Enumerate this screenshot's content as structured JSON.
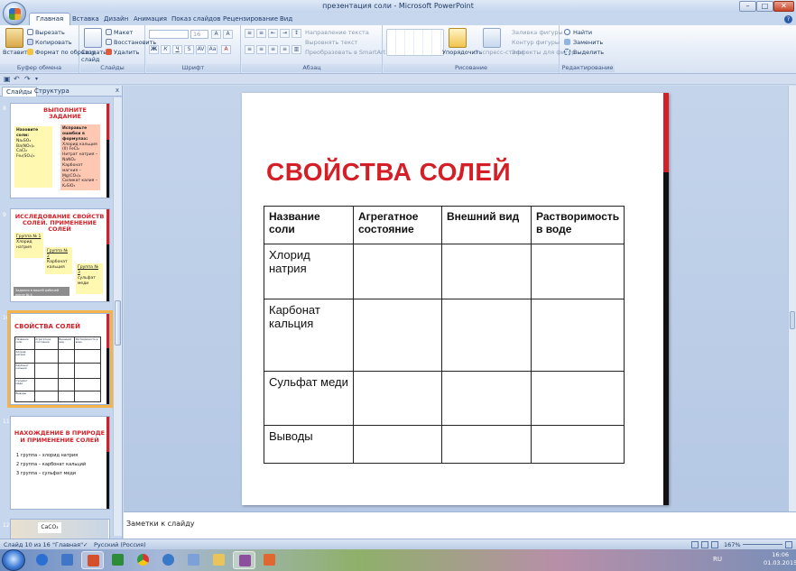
{
  "window": {
    "title": "презентация соли - Microsoft PowerPoint"
  },
  "tabs": [
    "Главная",
    "Вставка",
    "Дизайн",
    "Анимация",
    "Показ слайдов",
    "Рецензирование",
    "Вид"
  ],
  "ribbon": {
    "clipboard": {
      "label": "Буфер обмена",
      "paste": "Вставить",
      "cut": "Вырезать",
      "copy": "Копировать",
      "format_painter": "Формат по образцу"
    },
    "slides": {
      "label": "Слайды",
      "new_slide": "Создать слайд",
      "layout": "Макет",
      "reset": "Восстановить",
      "delete": "Удалить"
    },
    "font": {
      "label": "Шрифт",
      "size": "16"
    },
    "paragraph": {
      "label": "Абзац",
      "text_direction": "Направление текста",
      "align_text": "Выровнять текст",
      "smartart": "Преобразовать в SmartArt"
    },
    "drawing": {
      "label": "Рисование",
      "arrange": "Упорядочить",
      "quick_styles": "Экспресс-стили",
      "fill": "Заливка фигуры",
      "outline": "Контур фигуры",
      "effects": "Эффекты для фигур"
    },
    "editing": {
      "label": "Редактирование",
      "find": "Найти",
      "replace": "Заменить",
      "select": "Выделить"
    }
  },
  "panel": {
    "tab_slides": "Слайды",
    "tab_outline": "Структура",
    "close": "x"
  },
  "thumbnails": [
    {
      "number": "8",
      "title": "ВЫПОЛНИТЕ ЗАДАНИЕ",
      "note1_heading": "Назовите соли:",
      "note1_lines": [
        "Na₂SO₄",
        "Ba(NO₃)₂",
        "CaCl₂",
        "Fe₂(SO₄)₃"
      ],
      "note2_heading": "Исправьте ошибки в формулах:",
      "note2_lines": [
        "Хлорид кальция (II) FeCl₂",
        "Нитрат натрия – NaNO₂",
        "Карбонат магния – Mg(CO₃)₂",
        "Силикат калия – K₂SiO₃"
      ]
    },
    {
      "number": "9",
      "title": "ИССЛЕДОВАНИЕ СВОЙСТВ СОЛЕЙ. ПРИМЕНЕНИЕ СОЛЕЙ",
      "group1": "Группа № 1",
      "group1_text": "Хлорид натрия",
      "group2": "Группа № 2",
      "group2_text": "Карбонат кальция",
      "group3": "Группа № 3",
      "group3_text": "сульфат меди",
      "bar_text": "Задания в вашей рабочей листе № 4"
    },
    {
      "number": "10",
      "title": "СВОЙСТВА СОЛЕЙ"
    },
    {
      "number": "11",
      "title": "НАХОЖДЕНИЕ В ПРИРОДЕ И ПРИМЕНЕНИЕ СОЛЕЙ",
      "lines": [
        "1 группа – хлорид натрия",
        "2 группа – карбонат кальций",
        "3 группа – сульфат меди"
      ]
    },
    {
      "number": "12",
      "label": "CaCO₃"
    }
  ],
  "slide": {
    "title": "СВОЙСТВА СОЛЕЙ",
    "headers": [
      "Название соли",
      "Агрегатное состояние",
      "Внешний вид",
      "Растворимость в воде"
    ],
    "rows": [
      "Хлорид натрия",
      "Карбонат кальция",
      "Сульфат меди",
      "Выводы"
    ]
  },
  "notes": {
    "placeholder": "Заметки к слайду"
  },
  "status": {
    "slide_info": "Слайд 10 из 16",
    "theme": "\"Главная\"",
    "language": "Русский (Россия)",
    "zoom": "167%"
  },
  "taskbar": {
    "lang": "RU",
    "time": "16:06",
    "date": "01.03.2015"
  }
}
